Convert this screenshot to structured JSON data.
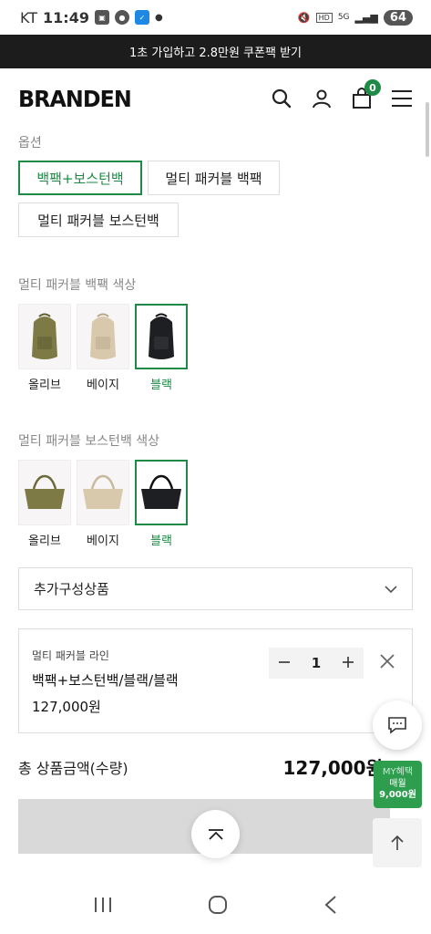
{
  "status_bar": {
    "carrier": "KT",
    "time": "11:49",
    "battery": "64",
    "network": "5G"
  },
  "promo_banner": "1초 가입하고 2.8만원 쿠폰팩 받기",
  "header": {
    "logo": "BRANDEN",
    "cart_count": "0"
  },
  "options": {
    "label": "옵션",
    "items": [
      "백팩+보스턴백",
      "멀티 패커블 백팩",
      "멀티 패커블 보스턴백"
    ],
    "selected_index": 0
  },
  "backpack_color": {
    "label": "멀티 패커블 백팩 색상",
    "swatches": [
      "올리브",
      "베이지",
      "블랙"
    ],
    "selected_index": 2
  },
  "boston_color": {
    "label": "멀티 패커블 보스턴백 색상",
    "swatches": [
      "올리브",
      "베이지",
      "블랙"
    ],
    "selected_index": 2
  },
  "additional_products": {
    "label": "추가구성상품"
  },
  "cart_item": {
    "line_name": "멀티 패커블 라인",
    "option_name": "백팩+보스턴백/블랙/블랙",
    "price": "127,000원",
    "quantity": "1"
  },
  "total": {
    "label": "총 상품금액(수량)",
    "amount": "127,000원"
  },
  "my_benefit": {
    "title": "MY혜택",
    "period": "매월",
    "amount": "9,000원"
  },
  "colors": {
    "accent": "#1f8a45",
    "olive": "#7d7a45",
    "beige": "#d8c9ad",
    "black": "#1d1f22"
  }
}
